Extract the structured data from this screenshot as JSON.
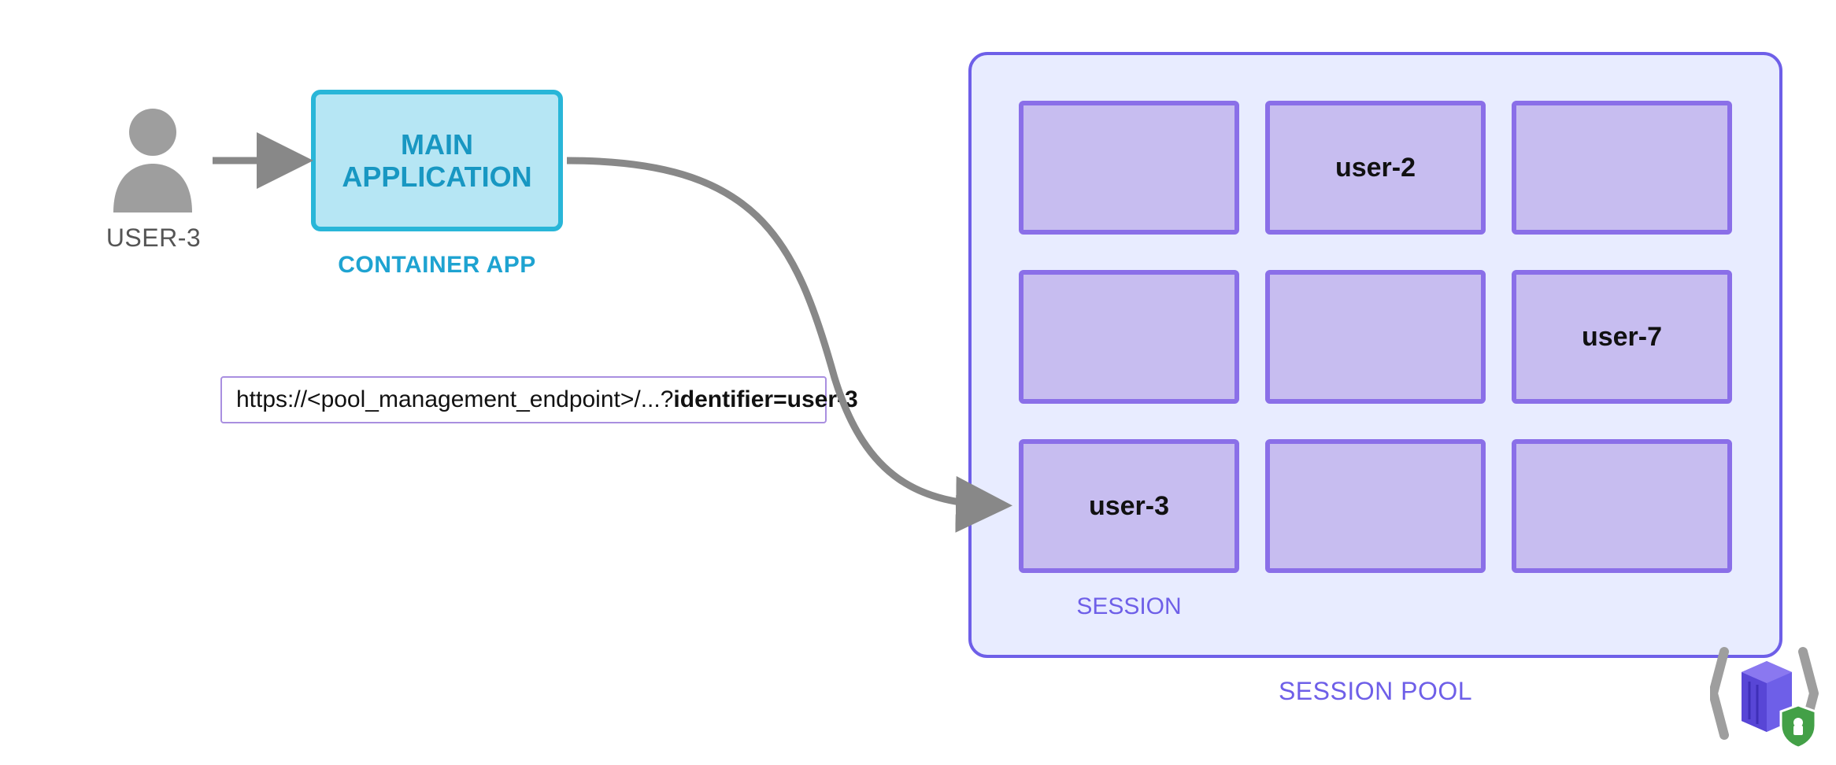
{
  "user": {
    "label": "USER-3"
  },
  "app": {
    "title_line1": "MAIN",
    "title_line2": "APPLICATION",
    "caption": "CONTAINER APP"
  },
  "url": {
    "prefix": "https://<pool_management_endpoint>/...?",
    "bold": "identifier=user-3"
  },
  "pool": {
    "caption": "SESSION POOL",
    "session_caption": "SESSION",
    "cells": [
      {
        "label": ""
      },
      {
        "label": "user-2"
      },
      {
        "label": ""
      },
      {
        "label": ""
      },
      {
        "label": ""
      },
      {
        "label": "user-7"
      },
      {
        "label": "user-3"
      },
      {
        "label": ""
      },
      {
        "label": ""
      }
    ]
  },
  "colors": {
    "gray": "#888888",
    "teal_border": "#29b6d8",
    "teal_fill": "#b6e6f4",
    "teal_text": "#1897c2",
    "purple_border": "#6e5fe8",
    "purple_fill": "#e8ecff",
    "cell_border": "#8a6fe8",
    "cell_fill": "#c7bdf0",
    "shield_green": "#43a047"
  }
}
